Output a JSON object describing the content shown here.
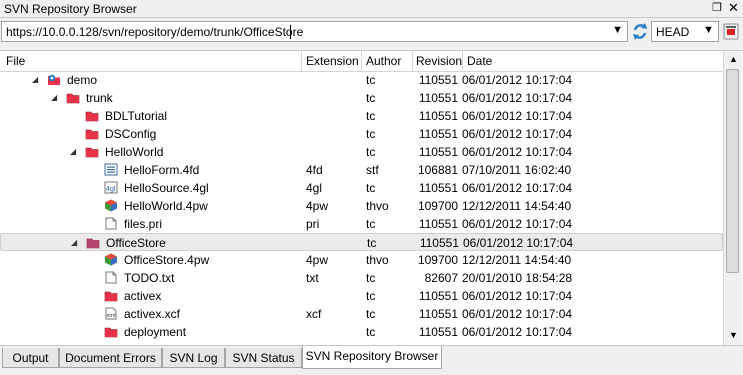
{
  "window": {
    "title": "SVN Repository Browser"
  },
  "toolbar": {
    "url": "https://10.0.0.128/svn/repository/demo/trunk/OfficeStore",
    "revision": "HEAD"
  },
  "columns": {
    "file": "File",
    "extension": "Extension",
    "author": "Author",
    "revision": "Revision",
    "date": "Date"
  },
  "rows": [
    {
      "name": "demo",
      "ext": "",
      "author": "tc",
      "rev": "110551",
      "date": "06/01/2012 10:17:04"
    },
    {
      "name": "trunk",
      "ext": "",
      "author": "tc",
      "rev": "110551",
      "date": "06/01/2012 10:17:04"
    },
    {
      "name": "BDLTutorial",
      "ext": "",
      "author": "tc",
      "rev": "110551",
      "date": "06/01/2012 10:17:04"
    },
    {
      "name": "DSConfig",
      "ext": "",
      "author": "tc",
      "rev": "110551",
      "date": "06/01/2012 10:17:04"
    },
    {
      "name": "HelloWorld",
      "ext": "",
      "author": "tc",
      "rev": "110551",
      "date": "06/01/2012 10:17:04"
    },
    {
      "name": "HelloForm.4fd",
      "ext": "4fd",
      "author": "stf",
      "rev": "106881",
      "date": "07/10/2011 16:02:40"
    },
    {
      "name": "HelloSource.4gl",
      "ext": "4gl",
      "author": "tc",
      "rev": "110551",
      "date": "06/01/2012 10:17:04"
    },
    {
      "name": "HelloWorld.4pw",
      "ext": "4pw",
      "author": "thvo",
      "rev": "109700",
      "date": "12/12/2011 14:54:40"
    },
    {
      "name": "files.pri",
      "ext": "pri",
      "author": "tc",
      "rev": "110551",
      "date": "06/01/2012 10:17:04"
    },
    {
      "name": "OfficeStore",
      "ext": "",
      "author": "tc",
      "rev": "110551",
      "date": "06/01/2012 10:17:04"
    },
    {
      "name": "OfficeStore.4pw",
      "ext": "4pw",
      "author": "thvo",
      "rev": "109700",
      "date": "12/12/2011 14:54:40"
    },
    {
      "name": "TODO.txt",
      "ext": "txt",
      "author": "tc",
      "rev": "82607",
      "date": "20/01/2010 18:54:28"
    },
    {
      "name": "activex",
      "ext": "",
      "author": "tc",
      "rev": "110551",
      "date": "06/01/2012 10:17:04"
    },
    {
      "name": "activex.xcf",
      "ext": "xcf",
      "author": "tc",
      "rev": "110551",
      "date": "06/01/2012 10:17:04"
    },
    {
      "name": "deployment",
      "ext": "",
      "author": "tc",
      "rev": "110551",
      "date": "06/01/2012 10:17:04"
    }
  ],
  "tabs": [
    "Output",
    "Document Errors",
    "SVN Log",
    "SVN Status",
    "SVN Repository Browser"
  ],
  "colors": {
    "folder": "#e8324a",
    "selected_row": "#ebebeb"
  }
}
